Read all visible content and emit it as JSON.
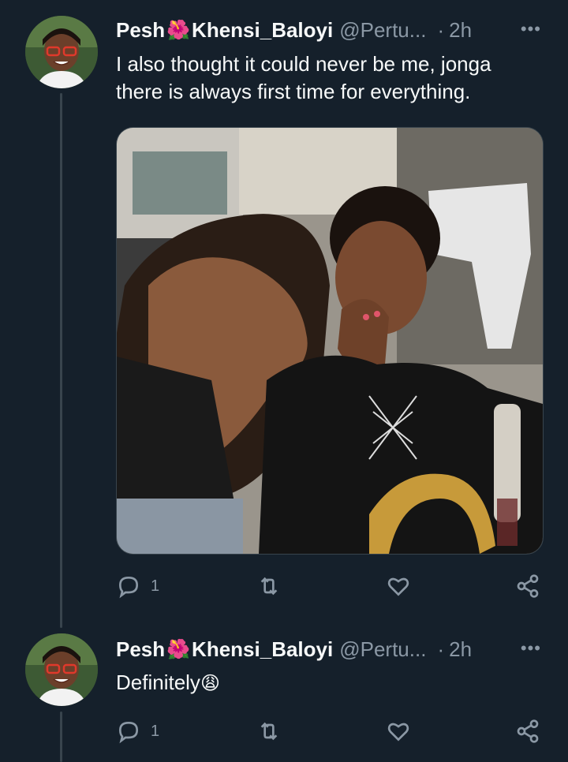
{
  "tweets": [
    {
      "display_name_prefix": "Pesh",
      "flower_emoji": "🌺",
      "display_name_suffix": "Khensi_Baloyi",
      "handle": "@Pertu...",
      "separator": "·",
      "time": "2h",
      "more": "•••",
      "text_line1": "I also thought it could never be me, jonga",
      "text_line2": "there is always first time for everything.",
      "reply_count": "1"
    },
    {
      "display_name_prefix": "Pesh",
      "flower_emoji": "🌺",
      "display_name_suffix": "Khensi_Baloyi",
      "handle": "@Pertu...",
      "separator": "·",
      "time": "2h",
      "more": "•••",
      "text": "Definitely",
      "text_emoji": "😩",
      "reply_count": "1"
    }
  ],
  "icons": {
    "reply": "reply-icon",
    "retweet": "retweet-icon",
    "like": "heart-icon",
    "share": "share-icon",
    "more": "more-icon"
  },
  "colors": {
    "background": "#15202b",
    "text": "#f7f9f9",
    "secondary": "#8b98a5",
    "thread_line": "#38444d"
  }
}
